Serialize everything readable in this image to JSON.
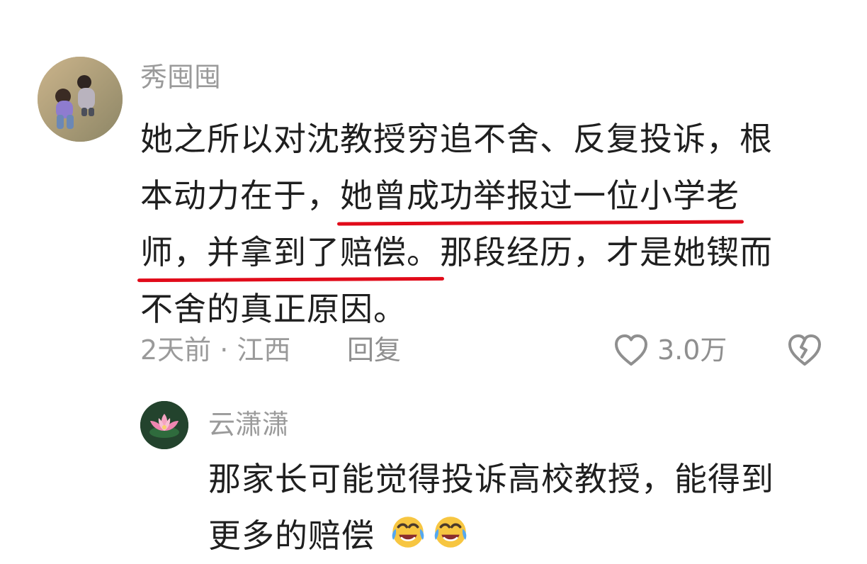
{
  "comment": {
    "username": "秀囤囤",
    "text_lines": [
      "她之所以对沈教授穷追不舍、反复投诉，根",
      "本动力在于，",
      "她曾成功举报过一位小学老",
      "师，并拿到了赔偿。",
      "那段经历，才是她锲而",
      "不舍的真正原因。"
    ],
    "meta": {
      "time_location": "2天前 · 江西",
      "reply_label": "回复",
      "like_count": "3.0万"
    },
    "icons": {
      "like": "heart-outline-icon",
      "dislike": "broken-heart-icon"
    }
  },
  "reply": {
    "username": "云潇潇",
    "text_line_1": "那家长可能觉得投诉高校教授，能得到",
    "text_line_2": "更多的赔偿",
    "emojis": [
      "tears-of-joy-emoji",
      "tears-of-joy-emoji"
    ]
  },
  "colors": {
    "username": "#9a9a9a",
    "text": "#1f1f1f",
    "underline": "#e10b1a"
  }
}
